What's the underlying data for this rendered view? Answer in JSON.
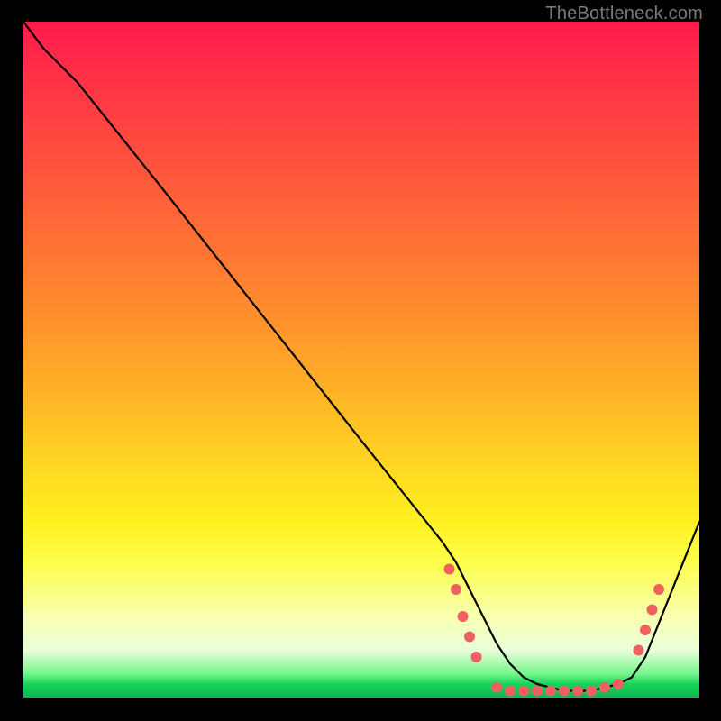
{
  "watermark": "TheBottleneck.com",
  "chart_data": {
    "type": "line",
    "title": "",
    "xlabel": "",
    "ylabel": "",
    "xlim": [
      0,
      100
    ],
    "ylim": [
      0,
      100
    ],
    "grid": false,
    "legend": false,
    "series": [
      {
        "name": "curve",
        "color": "#000000",
        "x": [
          0,
          3,
          8,
          20,
          35,
          50,
          62,
          64,
          66,
          68,
          70,
          72,
          74,
          76,
          78,
          80,
          82,
          84,
          86,
          88,
          90,
          92,
          94,
          100
        ],
        "y": [
          100,
          96,
          91,
          76,
          57,
          38,
          23,
          20,
          16,
          12,
          8,
          5,
          3,
          2,
          1.5,
          1,
          1,
          1,
          1.5,
          2,
          3,
          6,
          11,
          26
        ]
      }
    ],
    "markers": [
      {
        "x": 63,
        "y": 19,
        "color": "#f06060"
      },
      {
        "x": 64,
        "y": 16,
        "color": "#f06060"
      },
      {
        "x": 65,
        "y": 12,
        "color": "#f06060"
      },
      {
        "x": 66,
        "y": 9,
        "color": "#f06060"
      },
      {
        "x": 67,
        "y": 6,
        "color": "#f06060"
      },
      {
        "x": 70,
        "y": 1.5,
        "color": "#f06060"
      },
      {
        "x": 72,
        "y": 1,
        "color": "#f06060"
      },
      {
        "x": 74,
        "y": 1,
        "color": "#f06060"
      },
      {
        "x": 76,
        "y": 1,
        "color": "#f06060"
      },
      {
        "x": 78,
        "y": 1,
        "color": "#f06060"
      },
      {
        "x": 80,
        "y": 1,
        "color": "#f06060"
      },
      {
        "x": 82,
        "y": 1,
        "color": "#f06060"
      },
      {
        "x": 84,
        "y": 1,
        "color": "#f06060"
      },
      {
        "x": 86,
        "y": 1.5,
        "color": "#f06060"
      },
      {
        "x": 88,
        "y": 2,
        "color": "#f06060"
      },
      {
        "x": 91,
        "y": 7,
        "color": "#f06060"
      },
      {
        "x": 92,
        "y": 10,
        "color": "#f06060"
      },
      {
        "x": 93,
        "y": 13,
        "color": "#f06060"
      },
      {
        "x": 94,
        "y": 16,
        "color": "#f06060"
      }
    ]
  }
}
